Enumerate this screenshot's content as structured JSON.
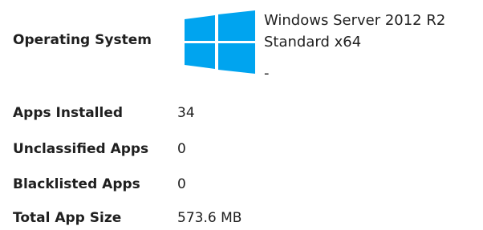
{
  "operating_system": {
    "label": "Operating System",
    "icon": "windows-logo-icon",
    "logo_color": "#00a4ef",
    "name": "Windows Server 2012 R2 Standard x64",
    "extra": "-"
  },
  "stats": [
    {
      "label": "Apps Installed",
      "value": "34"
    },
    {
      "label": "Unclassified Apps",
      "value": "0"
    },
    {
      "label": "Blacklisted Apps",
      "value": "0"
    },
    {
      "label": "Total App Size",
      "value": "573.6 MB"
    }
  ]
}
